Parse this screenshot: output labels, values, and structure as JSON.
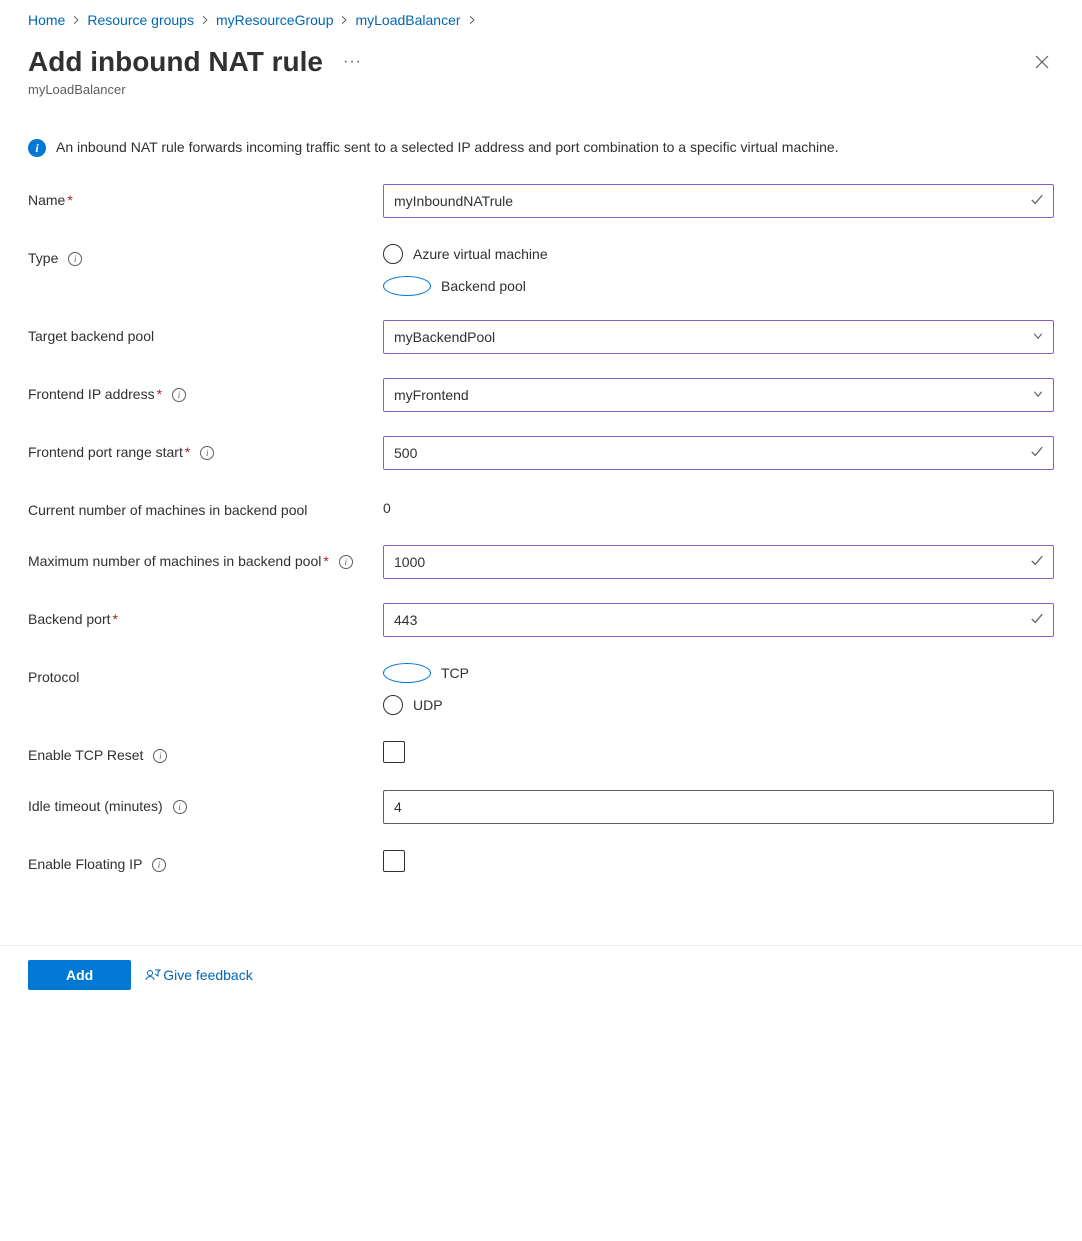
{
  "breadcrumb": [
    {
      "label": "Home"
    },
    {
      "label": "Resource groups"
    },
    {
      "label": "myResourceGroup"
    },
    {
      "label": "myLoadBalancer"
    }
  ],
  "header": {
    "title": "Add inbound NAT rule",
    "subtitle": "myLoadBalancer"
  },
  "info_text": "An inbound NAT rule forwards incoming traffic sent to a selected IP address and port combination to a specific virtual machine.",
  "form": {
    "name": {
      "label": "Name",
      "required": true,
      "value": "myInboundNATrule"
    },
    "type": {
      "label": "Type",
      "hint": true,
      "options": {
        "vm": "Azure virtual machine",
        "pool": "Backend pool"
      },
      "selected": "pool"
    },
    "target_pool": {
      "label": "Target backend pool",
      "value": "myBackendPool"
    },
    "frontend_ip": {
      "label": "Frontend IP address",
      "required": true,
      "hint": true,
      "value": "myFrontend"
    },
    "port_start": {
      "label": "Frontend port range start",
      "required": true,
      "hint": true,
      "value": "500"
    },
    "current_machines": {
      "label": "Current number of machines in backend pool",
      "value": "0"
    },
    "max_machines": {
      "label": "Maximum number of machines in backend pool",
      "required": true,
      "hint": true,
      "value": "1000"
    },
    "backend_port": {
      "label": "Backend port",
      "required": true,
      "value": "443"
    },
    "protocol": {
      "label": "Protocol",
      "options": {
        "tcp": "TCP",
        "udp": "UDP"
      },
      "selected": "tcp"
    },
    "tcp_reset": {
      "label": "Enable TCP Reset",
      "hint": true,
      "checked": false
    },
    "idle_timeout": {
      "label": "Idle timeout (minutes)",
      "hint": true,
      "value": "4"
    },
    "floating_ip": {
      "label": "Enable Floating IP",
      "hint": true,
      "checked": false
    }
  },
  "footer": {
    "add": "Add",
    "feedback": "Give feedback"
  }
}
